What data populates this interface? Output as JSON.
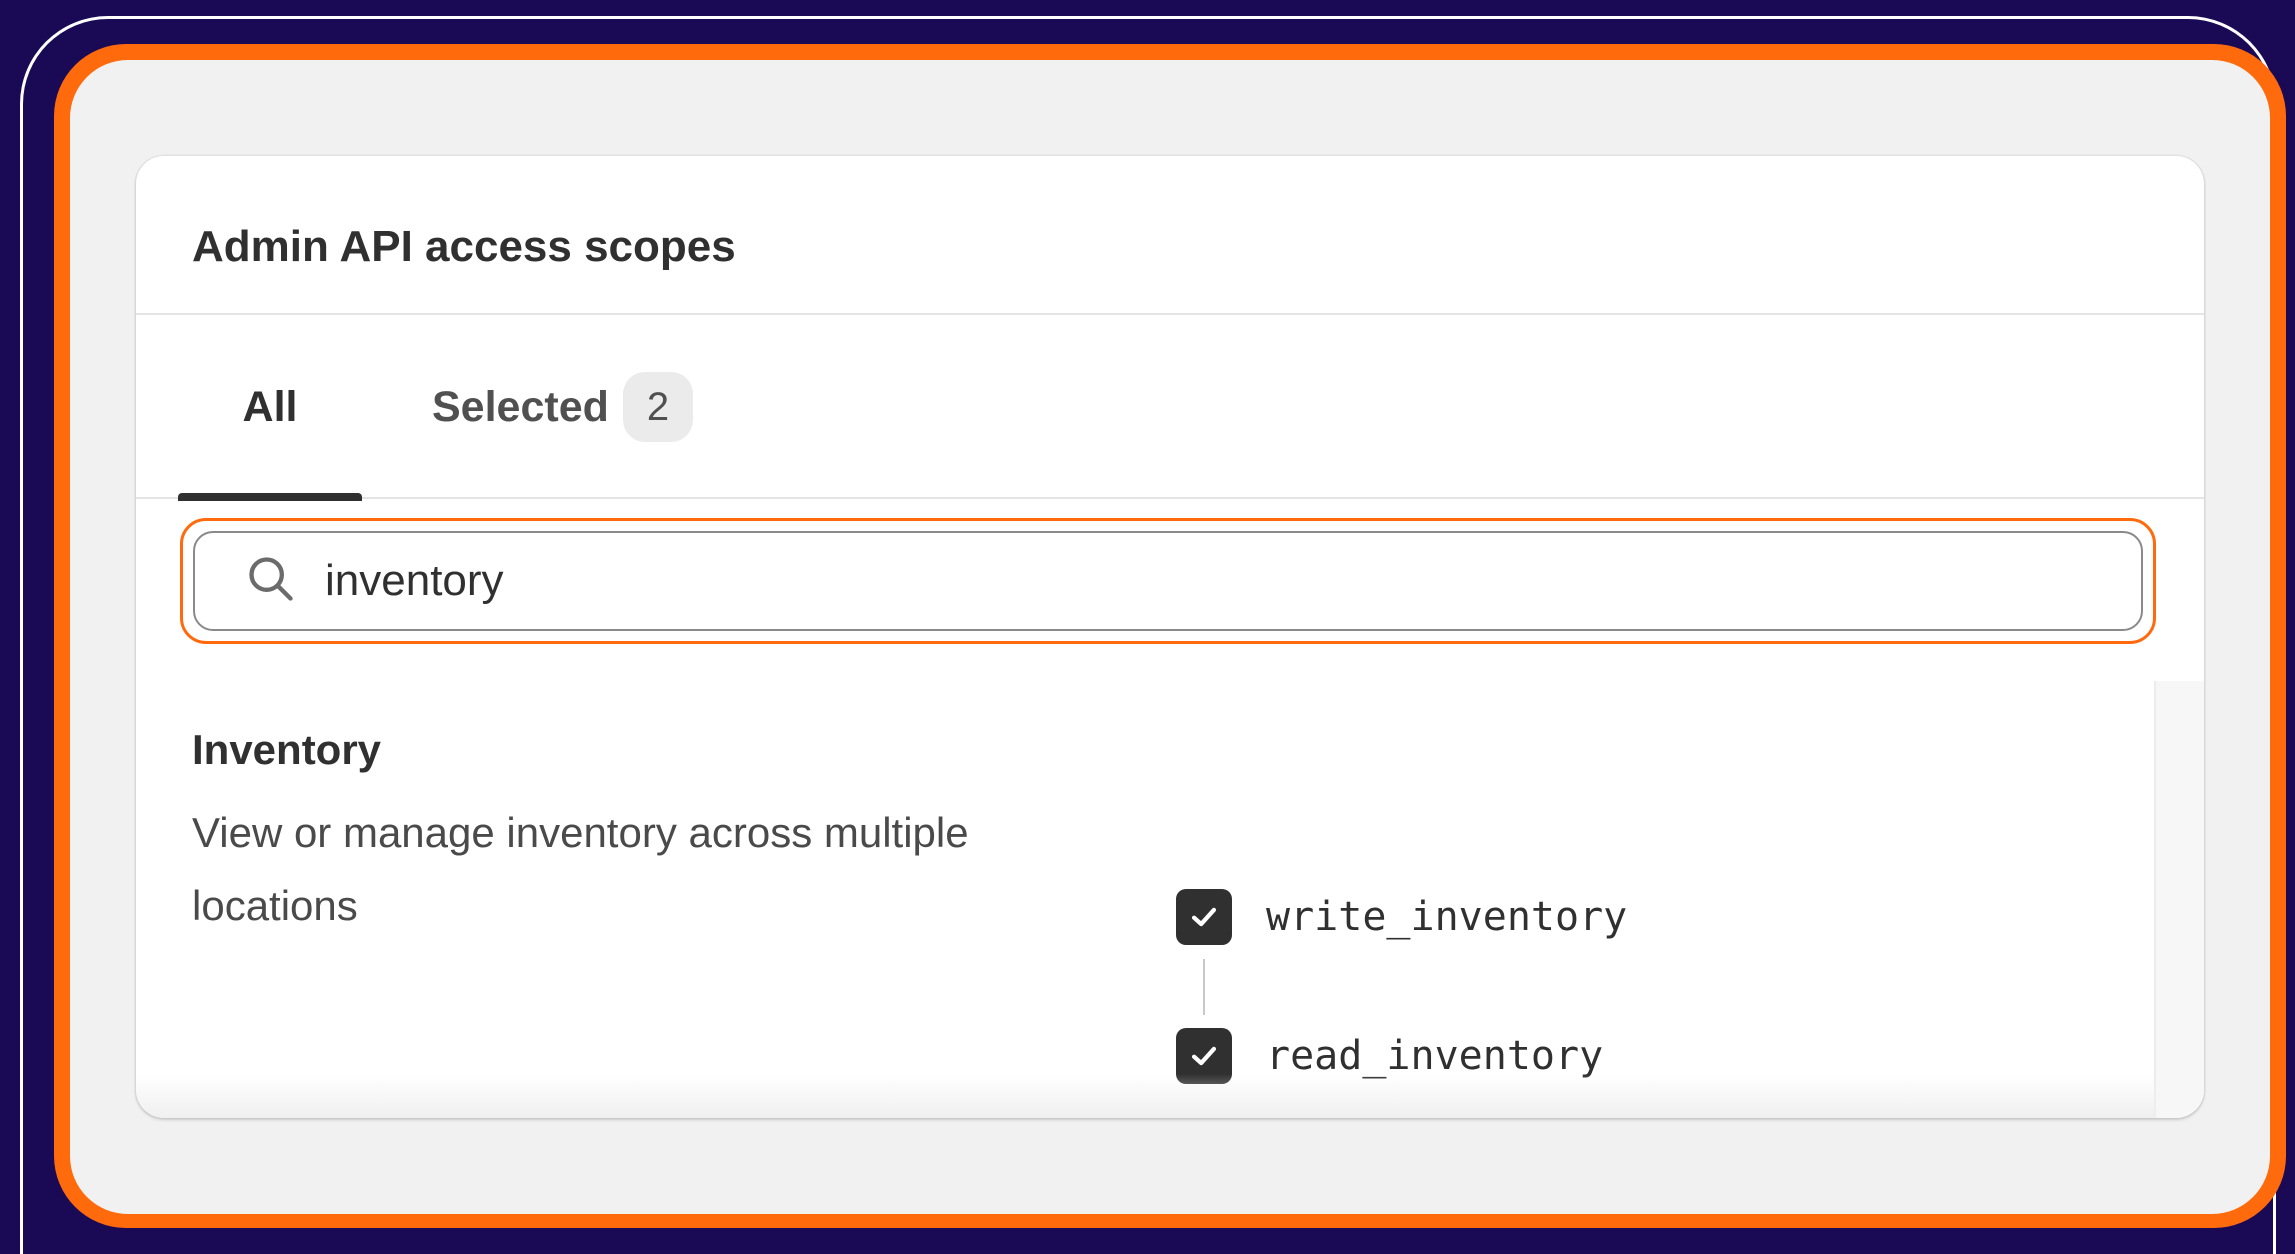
{
  "card": {
    "title": "Admin API access scopes"
  },
  "tabs": [
    {
      "label": "All",
      "active": true
    },
    {
      "label": "Selected",
      "count": "2",
      "active": false
    }
  ],
  "search": {
    "value": "inventory",
    "icon": "search-icon"
  },
  "section": {
    "title": "Inventory",
    "description": "View or manage inventory across multiple locations",
    "scopes": [
      {
        "name": "write_inventory",
        "checked": true
      },
      {
        "name": "read_inventory",
        "checked": true
      }
    ]
  },
  "colors": {
    "background": "#1a0a55",
    "accent_orange": "#ff6a0d",
    "checkbox": "#303030"
  }
}
